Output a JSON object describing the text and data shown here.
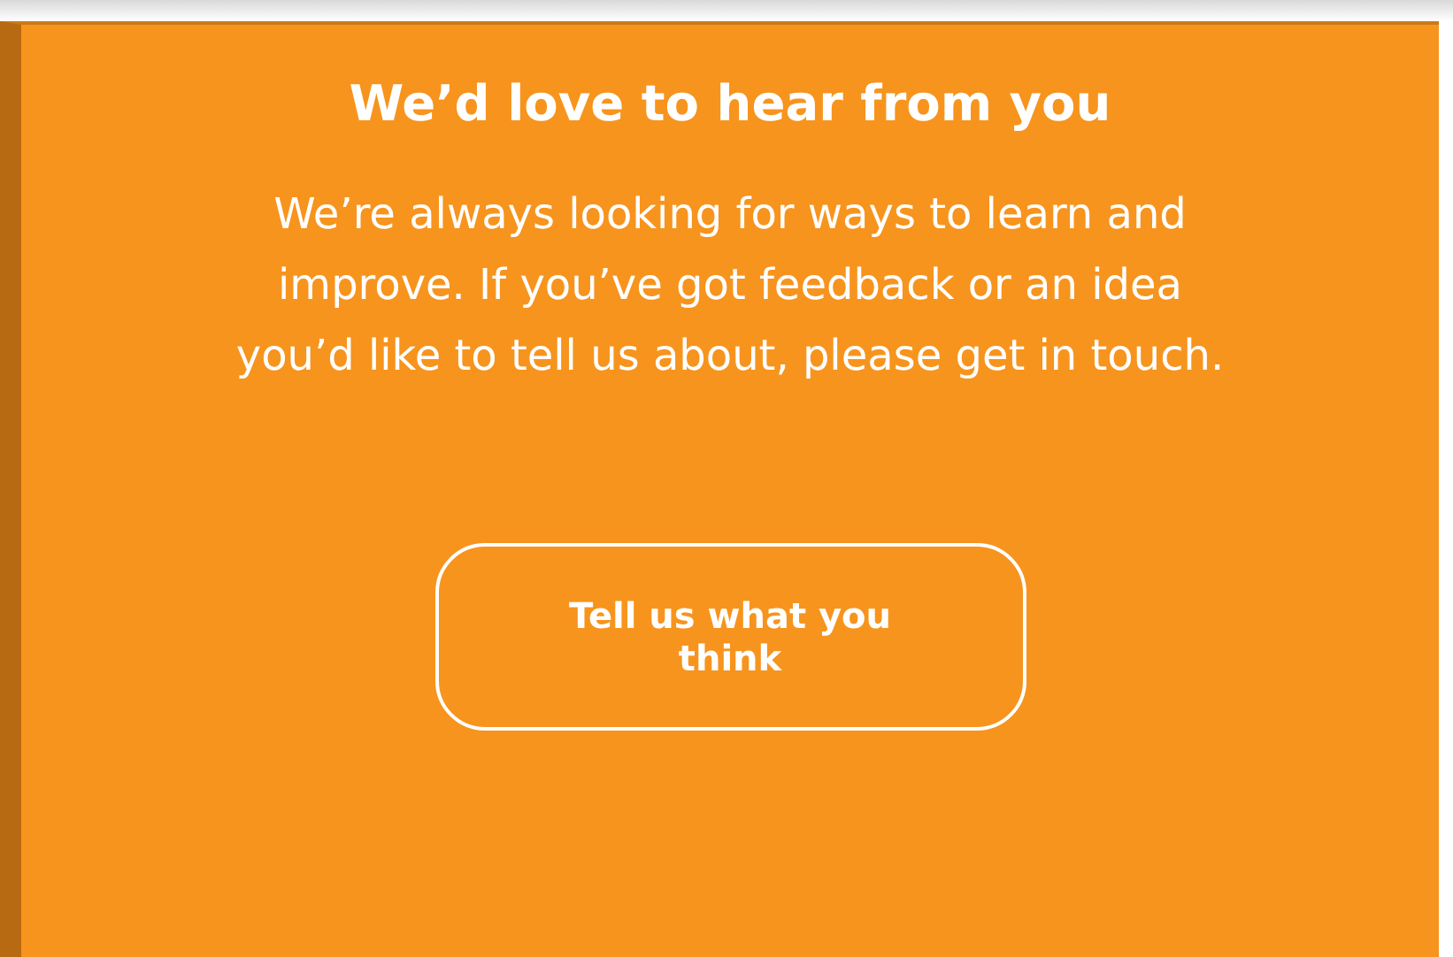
{
  "card": {
    "title": "We’d love to hear from you",
    "body": "We’re always looking for ways to learn and improve. If you’ve got feedback or an idea you’d like to tell us about, please get in touch.",
    "button": "Tell us what you think"
  }
}
